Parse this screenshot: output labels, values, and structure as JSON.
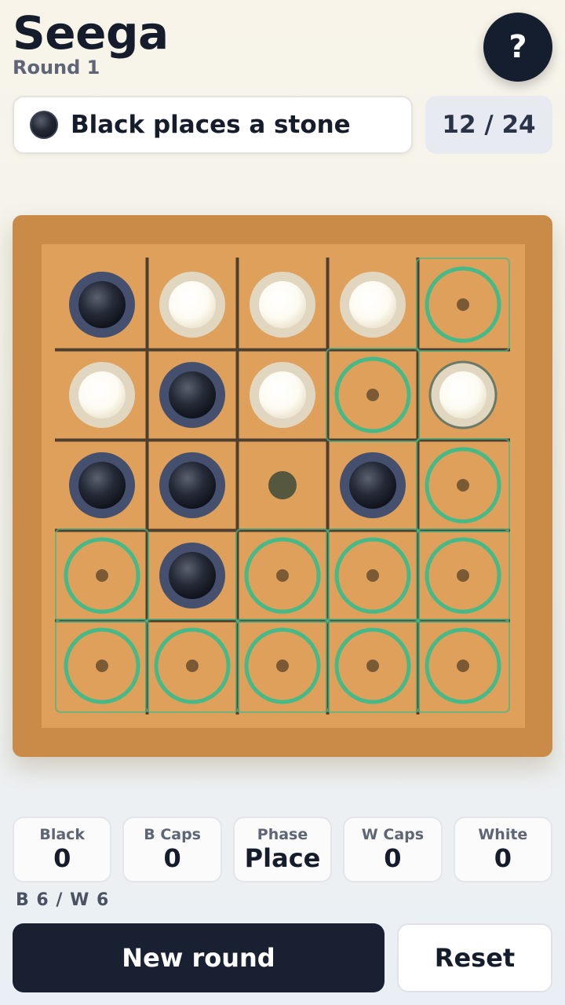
{
  "header": {
    "title": "Seega",
    "round_label": "Round 1",
    "help_label": "?"
  },
  "status": {
    "text": "Black places a stone",
    "stone_color": "black",
    "count": "12 / 24"
  },
  "board": {
    "size": 5,
    "cells": [
      [
        "black",
        "white",
        "white",
        "white",
        "target"
      ],
      [
        "white",
        "black",
        "white",
        "target",
        "white-last"
      ],
      [
        "black",
        "black",
        "center",
        "black",
        "target"
      ],
      [
        "target",
        "black",
        "target",
        "target",
        "target"
      ],
      [
        "target",
        "target",
        "target",
        "target",
        "target"
      ]
    ],
    "colors": {
      "frame": "#c98b47",
      "inner": "#dea05a",
      "grid": "#4e4030",
      "target": "#45b987",
      "black_stone": "#22283a",
      "white_stone": "#fdfbf2",
      "center_marker": "#55583e"
    }
  },
  "stats": [
    {
      "label": "Black",
      "value": "0"
    },
    {
      "label": "B Caps",
      "value": "0"
    },
    {
      "label": "Phase",
      "value": "Place"
    },
    {
      "label": "W Caps",
      "value": "0"
    },
    {
      "label": "White",
      "value": "0"
    }
  ],
  "remaining": "B 6 / W 6",
  "buttons": {
    "new_round": "New round",
    "reset": "Reset"
  }
}
